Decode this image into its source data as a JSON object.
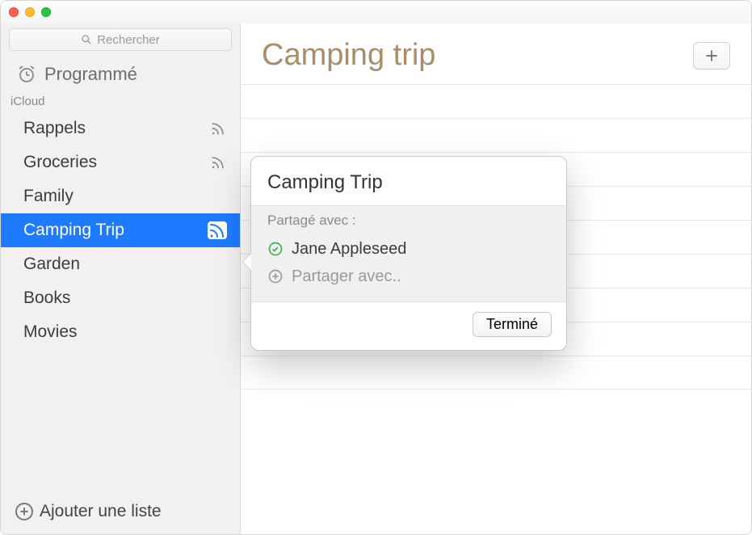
{
  "search": {
    "placeholder": "Rechercher"
  },
  "scheduled": {
    "label": "Programmé"
  },
  "section": {
    "label": "iCloud"
  },
  "lists": [
    {
      "name": "Rappels",
      "shared": true,
      "selected": false
    },
    {
      "name": "Groceries",
      "shared": true,
      "selected": false
    },
    {
      "name": "Family",
      "shared": false,
      "selected": false
    },
    {
      "name": "Camping Trip",
      "shared": true,
      "selected": true
    },
    {
      "name": "Garden",
      "shared": false,
      "selected": false
    },
    {
      "name": "Books",
      "shared": false,
      "selected": false
    },
    {
      "name": "Movies",
      "shared": false,
      "selected": false
    }
  ],
  "add_list": {
    "label": "Ajouter une liste"
  },
  "main": {
    "title": "Camping trip"
  },
  "popover": {
    "title": "Camping Trip",
    "shared_label": "Partagé avec :",
    "people": [
      {
        "name": "Jane Appleseed"
      }
    ],
    "add_placeholder": "Partager avec..",
    "done": "Terminé"
  }
}
